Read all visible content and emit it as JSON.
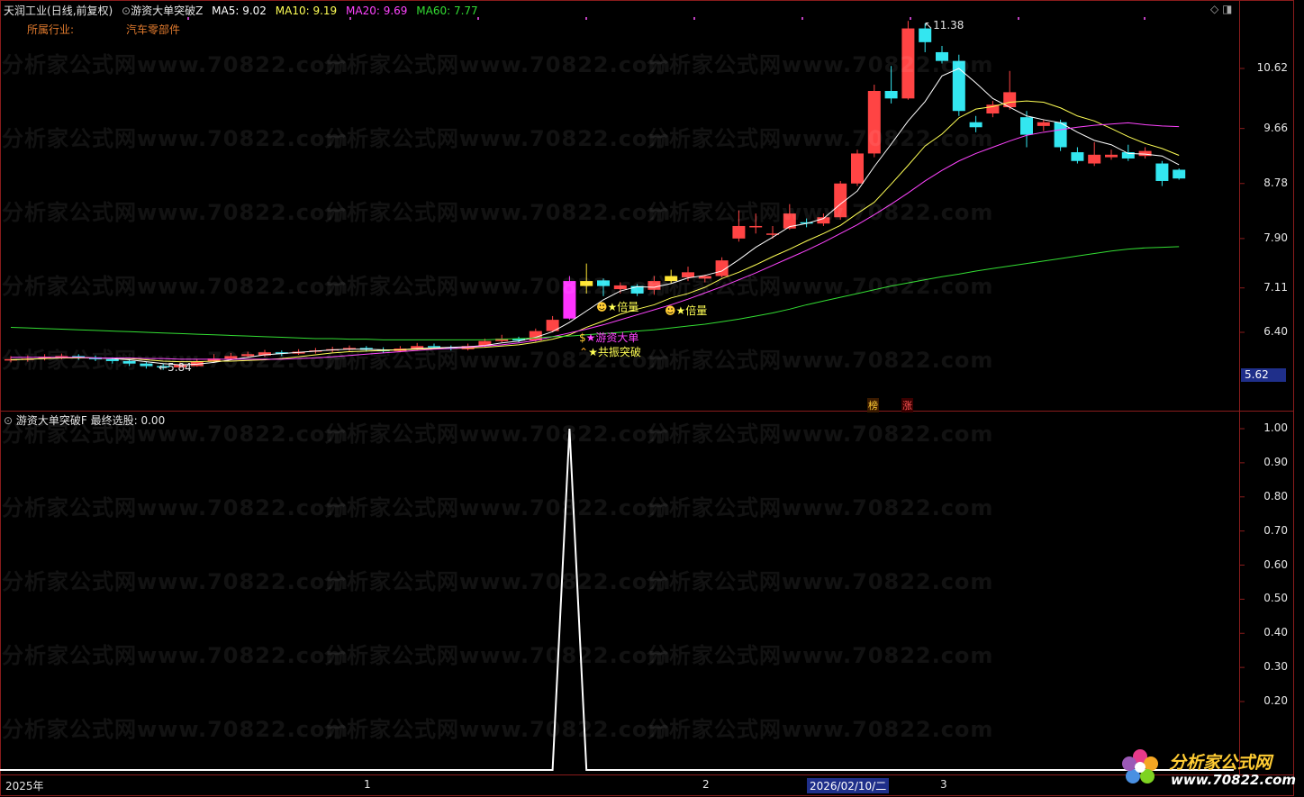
{
  "header": {
    "stock_name": "天润工业",
    "period": "(日线,前复权)",
    "indicator_name": "游资大单突破Z",
    "ma": [
      {
        "label": "MA5: 9.02",
        "color": "#ffffff"
      },
      {
        "label": "MA10: 9.19",
        "color": "#ffff55"
      },
      {
        "label": "MA20: 9.69",
        "color": "#ff44ff"
      },
      {
        "label": "MA60: 7.77",
        "color": "#33dd33"
      }
    ]
  },
  "industry": {
    "label": "所属行业:",
    "value": "汽车零部件"
  },
  "markers": {
    "high_label": "11.38",
    "low_label": "5.84",
    "current_price": "5.62",
    "signal_times_volume": "★倍量",
    "signal_big_order": "★游资大单",
    "signal_breakout": "★共振突破",
    "tag_bang": "榜",
    "tag_zhang": "涨"
  },
  "indicator": {
    "name": "游资大单突破F",
    "value_label": "最终选股: 0.00"
  },
  "x_axis": {
    "year": "2025年",
    "m1": "1",
    "m2": "2",
    "cursor_date": "2026/02/10/二",
    "m3": "3"
  },
  "watermark": "分析家公式网www.70822.com",
  "logo": {
    "text": "分析家公式网",
    "url": "www.70822.com"
  },
  "chart_data": [
    {
      "type": "candlestick",
      "title": "天润工业 (日线,前复权)",
      "y_ticks": [
        10.62,
        9.66,
        8.78,
        7.9,
        7.11,
        6.4
      ],
      "ylim": [
        5.5,
        11.6
      ],
      "candles": [
        {
          "o": 5.95,
          "c": 5.97,
          "h": 6.02,
          "l": 5.92
        },
        {
          "o": 5.97,
          "c": 5.98,
          "h": 6.03,
          "l": 5.93
        },
        {
          "o": 5.99,
          "c": 6.01,
          "h": 6.05,
          "l": 5.95
        },
        {
          "o": 6.01,
          "c": 6.02,
          "h": 6.06,
          "l": 5.97
        },
        {
          "o": 6.02,
          "c": 6.0,
          "h": 6.05,
          "l": 5.96
        },
        {
          "o": 6.0,
          "c": 5.97,
          "h": 6.03,
          "l": 5.94
        },
        {
          "o": 5.97,
          "c": 5.94,
          "h": 6.0,
          "l": 5.9
        },
        {
          "o": 5.94,
          "c": 5.9,
          "h": 5.97,
          "l": 5.86
        },
        {
          "o": 5.9,
          "c": 5.86,
          "h": 5.93,
          "l": 5.82
        },
        {
          "o": 5.86,
          "c": 5.84,
          "h": 5.9,
          "l": 5.8
        },
        {
          "o": 5.84,
          "c": 5.88,
          "h": 5.92,
          "l": 5.83
        },
        {
          "o": 5.86,
          "c": 5.93,
          "h": 5.97,
          "l": 5.85
        },
        {
          "o": 5.93,
          "c": 5.98,
          "h": 6.05,
          "l": 5.91
        },
        {
          "o": 5.98,
          "c": 6.02,
          "h": 6.07,
          "l": 5.96
        },
        {
          "o": 6.02,
          "c": 6.05,
          "h": 6.09,
          "l": 6.0
        },
        {
          "o": 6.03,
          "c": 6.08,
          "h": 6.12,
          "l": 6.01
        },
        {
          "o": 6.08,
          "c": 6.06,
          "h": 6.11,
          "l": 6.02
        },
        {
          "o": 6.06,
          "c": 6.09,
          "h": 6.13,
          "l": 6.04
        },
        {
          "o": 6.09,
          "c": 6.11,
          "h": 6.15,
          "l": 6.06
        },
        {
          "o": 6.11,
          "c": 6.13,
          "h": 6.17,
          "l": 6.08
        },
        {
          "o": 6.13,
          "c": 6.15,
          "h": 6.19,
          "l": 6.1
        },
        {
          "o": 6.15,
          "c": 6.12,
          "h": 6.18,
          "l": 6.09
        },
        {
          "o": 6.12,
          "c": 6.1,
          "h": 6.16,
          "l": 6.07
        },
        {
          "o": 6.1,
          "c": 6.14,
          "h": 6.18,
          "l": 6.08
        },
        {
          "o": 6.14,
          "c": 6.18,
          "h": 6.23,
          "l": 6.12
        },
        {
          "o": 6.18,
          "c": 6.16,
          "h": 6.22,
          "l": 6.13
        },
        {
          "o": 6.16,
          "c": 6.14,
          "h": 6.19,
          "l": 6.11
        },
        {
          "o": 6.13,
          "c": 6.18,
          "h": 6.22,
          "l": 6.11
        },
        {
          "o": 6.18,
          "c": 6.26,
          "h": 6.3,
          "l": 6.16
        },
        {
          "o": 6.26,
          "c": 6.3,
          "h": 6.36,
          "l": 6.24
        },
        {
          "o": 6.3,
          "c": 6.27,
          "h": 6.33,
          "l": 6.24
        },
        {
          "o": 6.27,
          "c": 6.42,
          "h": 6.46,
          "l": 6.25
        },
        {
          "o": 6.42,
          "c": 6.6,
          "h": 6.66,
          "l": 6.4
        },
        {
          "o": 6.62,
          "c": 7.22,
          "h": 7.3,
          "l": 6.6
        },
        {
          "o": 7.22,
          "c": 7.14,
          "h": 7.5,
          "l": 7.02
        },
        {
          "o": 7.23,
          "c": 7.14,
          "h": 7.26,
          "l": 6.98
        },
        {
          "o": 7.09,
          "c": 7.15,
          "h": 7.2,
          "l": 7.02
        },
        {
          "o": 7.14,
          "c": 7.02,
          "h": 7.17,
          "l": 6.98
        },
        {
          "o": 7.08,
          "c": 7.22,
          "h": 7.3,
          "l": 7.0
        },
        {
          "o": 7.22,
          "c": 7.3,
          "h": 7.4,
          "l": 7.18
        },
        {
          "o": 7.28,
          "c": 7.36,
          "h": 7.45,
          "l": 7.22
        },
        {
          "o": 7.26,
          "c": 7.3,
          "h": 7.32,
          "l": 7.2
        },
        {
          "o": 7.3,
          "c": 7.55,
          "h": 7.6,
          "l": 7.28
        },
        {
          "o": 7.9,
          "c": 8.1,
          "h": 8.35,
          "l": 7.85
        },
        {
          "o": 8.08,
          "c": 8.1,
          "h": 8.3,
          "l": 7.98
        },
        {
          "o": 7.96,
          "c": 7.98,
          "h": 8.1,
          "l": 7.9
        },
        {
          "o": 8.06,
          "c": 8.3,
          "h": 8.45,
          "l": 8.04
        },
        {
          "o": 8.16,
          "c": 8.14,
          "h": 8.22,
          "l": 8.08
        },
        {
          "o": 8.14,
          "c": 8.24,
          "h": 8.3,
          "l": 8.1
        },
        {
          "o": 8.24,
          "c": 8.78,
          "h": 8.82,
          "l": 8.2
        },
        {
          "o": 8.78,
          "c": 9.26,
          "h": 9.32,
          "l": 8.74
        },
        {
          "o": 9.26,
          "c": 10.26,
          "h": 10.36,
          "l": 9.2
        },
        {
          "o": 10.26,
          "c": 10.14,
          "h": 10.66,
          "l": 10.06
        },
        {
          "o": 10.14,
          "c": 11.26,
          "h": 11.38,
          "l": 10.12
        },
        {
          "o": 11.26,
          "c": 11.04,
          "h": 11.34,
          "l": 10.88
        },
        {
          "o": 10.88,
          "c": 10.74,
          "h": 10.98,
          "l": 10.7
        },
        {
          "o": 10.74,
          "c": 9.94,
          "h": 10.84,
          "l": 9.86
        },
        {
          "o": 9.76,
          "c": 9.68,
          "h": 9.86,
          "l": 9.6
        },
        {
          "o": 9.9,
          "c": 10.04,
          "h": 10.1,
          "l": 9.84
        },
        {
          "o": 10.0,
          "c": 10.24,
          "h": 10.58,
          "l": 9.96
        },
        {
          "o": 9.84,
          "c": 9.56,
          "h": 9.94,
          "l": 9.36
        },
        {
          "o": 9.7,
          "c": 9.76,
          "h": 9.8,
          "l": 9.62
        },
        {
          "o": 9.76,
          "c": 9.36,
          "h": 9.8,
          "l": 9.3
        },
        {
          "o": 9.28,
          "c": 9.14,
          "h": 9.36,
          "l": 9.1
        },
        {
          "o": 9.1,
          "c": 9.24,
          "h": 9.44,
          "l": 9.06
        },
        {
          "o": 9.2,
          "c": 9.24,
          "h": 9.32,
          "l": 9.16
        },
        {
          "o": 9.28,
          "c": 9.18,
          "h": 9.4,
          "l": 9.14
        },
        {
          "o": 9.22,
          "c": 9.3,
          "h": 9.36,
          "l": 9.18
        },
        {
          "o": 9.1,
          "c": 8.82,
          "h": 9.14,
          "l": 8.74
        },
        {
          "o": 9.0,
          "c": 8.86,
          "h": 9.02,
          "l": 8.84
        }
      ],
      "series": [
        {
          "name": "MA5",
          "color": "#ffffff",
          "values": [
            5.96,
            5.97,
            5.98,
            5.99,
            6.0,
            5.99,
            5.98,
            5.96,
            5.93,
            5.9,
            5.88,
            5.89,
            5.92,
            5.96,
            6.0,
            6.04,
            6.06,
            6.08,
            6.1,
            6.12,
            6.13,
            6.13,
            6.12,
            6.12,
            6.14,
            6.15,
            6.16,
            6.17,
            6.19,
            6.23,
            6.26,
            6.32,
            6.41,
            6.56,
            6.74,
            6.92,
            7.06,
            7.13,
            7.12,
            7.18,
            7.27,
            7.31,
            7.38,
            7.56,
            7.76,
            7.92,
            8.09,
            8.14,
            8.22,
            8.45,
            8.66,
            9.05,
            9.41,
            9.78,
            10.09,
            10.5,
            10.62,
            10.39,
            10.14,
            10.0,
            9.86,
            9.8,
            9.75,
            9.6,
            9.47,
            9.4,
            9.26,
            9.25,
            9.22,
            9.08
          ]
        },
        {
          "name": "MA10",
          "color": "#ffff55",
          "values": [
            5.96,
            5.97,
            5.98,
            5.99,
            5.99,
            5.99,
            5.99,
            5.98,
            5.96,
            5.94,
            5.93,
            5.93,
            5.94,
            5.94,
            5.95,
            5.96,
            5.98,
            6.01,
            6.04,
            6.07,
            6.09,
            6.1,
            6.11,
            6.12,
            6.13,
            6.14,
            6.14,
            6.15,
            6.16,
            6.18,
            6.2,
            6.24,
            6.29,
            6.36,
            6.48,
            6.58,
            6.69,
            6.77,
            6.84,
            6.95,
            7.02,
            7.12,
            7.26,
            7.36,
            7.48,
            7.61,
            7.73,
            7.86,
            7.98,
            8.11,
            8.3,
            8.48,
            8.77,
            9.07,
            9.38,
            9.57,
            9.83,
            9.97,
            10.01,
            10.08,
            10.1,
            10.08,
            9.99,
            9.86,
            9.78,
            9.66,
            9.53,
            9.42,
            9.34,
            9.23
          ]
        },
        {
          "name": "MA20",
          "color": "#ff44ff",
          "values": [
            6.0,
            6.0,
            6.0,
            6.0,
            6.0,
            5.99,
            5.99,
            5.99,
            5.98,
            5.98,
            5.97,
            5.97,
            5.97,
            5.97,
            5.97,
            5.97,
            5.97,
            5.98,
            5.99,
            6.01,
            6.03,
            6.05,
            6.07,
            6.09,
            6.11,
            6.13,
            6.14,
            6.16,
            6.18,
            6.2,
            6.23,
            6.27,
            6.33,
            6.39,
            6.45,
            6.52,
            6.6,
            6.68,
            6.76,
            6.84,
            6.93,
            7.03,
            7.13,
            7.24,
            7.35,
            7.47,
            7.59,
            7.71,
            7.84,
            7.98,
            8.12,
            8.28,
            8.45,
            8.63,
            8.82,
            8.99,
            9.14,
            9.26,
            9.36,
            9.46,
            9.55,
            9.6,
            9.64,
            9.68,
            9.71,
            9.73,
            9.75,
            9.72,
            9.7,
            9.69
          ]
        },
        {
          "name": "MA60",
          "color": "#33dd33",
          "values": [
            6.48,
            6.47,
            6.46,
            6.45,
            6.44,
            6.43,
            6.42,
            6.41,
            6.4,
            6.39,
            6.38,
            6.37,
            6.36,
            6.35,
            6.34,
            6.33,
            6.32,
            6.31,
            6.3,
            6.3,
            6.29,
            6.29,
            6.28,
            6.28,
            6.28,
            6.28,
            6.28,
            6.28,
            6.28,
            6.29,
            6.3,
            6.31,
            6.33,
            6.34,
            6.36,
            6.38,
            6.4,
            6.42,
            6.44,
            6.47,
            6.5,
            6.53,
            6.57,
            6.61,
            6.66,
            6.71,
            6.77,
            6.84,
            6.9,
            6.96,
            7.02,
            7.08,
            7.14,
            7.19,
            7.24,
            7.29,
            7.33,
            7.38,
            7.42,
            7.46,
            7.5,
            7.54,
            7.58,
            7.62,
            7.66,
            7.7,
            7.73,
            7.75,
            7.76,
            7.77
          ]
        }
      ],
      "annotations": [
        "11.38",
        "5.84",
        "★倍量",
        "★倍量",
        "★游资大单",
        "★共振突破"
      ]
    },
    {
      "type": "line",
      "title": "游资大单突破F 最终选股: 0.00",
      "y_ticks": [
        1.0,
        0.9,
        0.8,
        0.7,
        0.6,
        0.5,
        0.4,
        0.3,
        0.2
      ],
      "ylim": [
        0,
        1.05
      ],
      "series": [
        {
          "name": "最终选股",
          "color": "#ffffff",
          "spike_index": 33,
          "values_note_free": true
        }
      ],
      "values": [
        0,
        0,
        0,
        0,
        0,
        0,
        0,
        0,
        0,
        0,
        0,
        0,
        0,
        0,
        0,
        0,
        0,
        0,
        0,
        0,
        0,
        0,
        0,
        0,
        0,
        0,
        0,
        0,
        0,
        0,
        0,
        0,
        0,
        1,
        0,
        0,
        0,
        0,
        0,
        0,
        0,
        0,
        0,
        0,
        0,
        0,
        0,
        0,
        0,
        0,
        0,
        0,
        0,
        0,
        0,
        0,
        0,
        0,
        0,
        0,
        0,
        0,
        0,
        0,
        0,
        0,
        0,
        0,
        0,
        0
      ]
    }
  ]
}
